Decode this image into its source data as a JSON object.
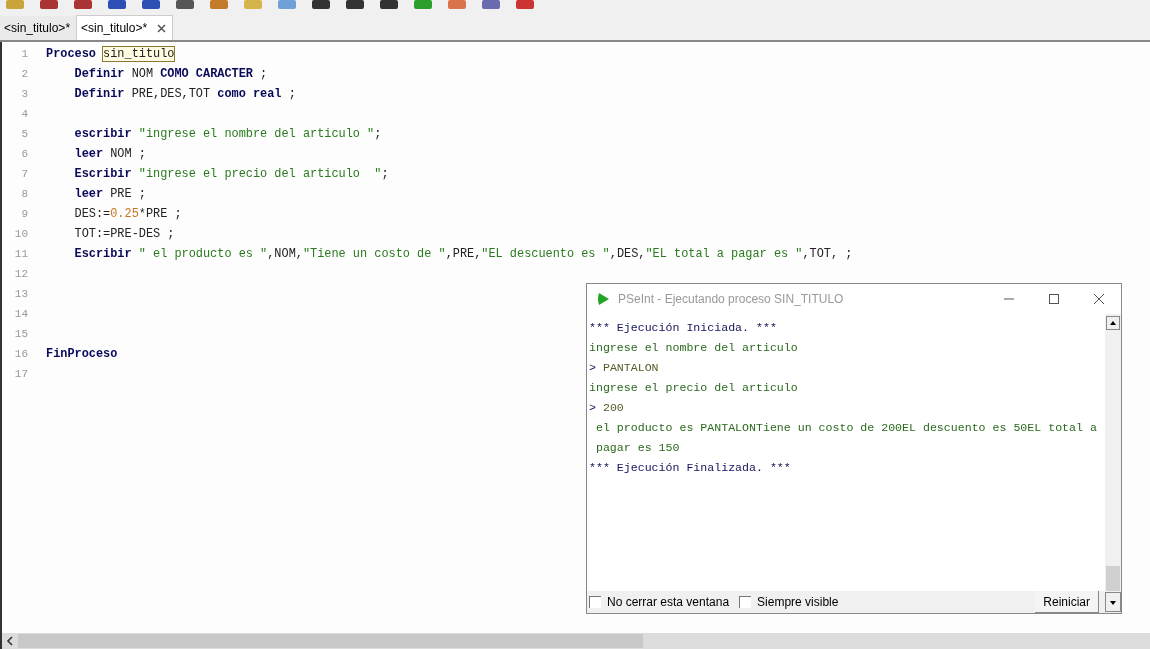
{
  "tabs": [
    {
      "label": "<sin_titulo>*",
      "selected": false,
      "closable": false
    },
    {
      "label": "<sin_titulo>*",
      "selected": true,
      "closable": true
    }
  ],
  "editor": {
    "lines": [
      {
        "number": "1",
        "tokens": [
          {
            "kind": "kw",
            "text": "Proceso "
          },
          {
            "kind": "hl",
            "text": "sin_titulo"
          }
        ]
      },
      {
        "number": "2",
        "tokens": [
          {
            "kind": "kw",
            "text": "    Definir "
          },
          {
            "kind": "id",
            "text": "NOM "
          },
          {
            "kind": "kw",
            "text": "COMO CARACTER "
          },
          {
            "kind": "id",
            "text": ";"
          }
        ]
      },
      {
        "number": "3",
        "tokens": [
          {
            "kind": "kw",
            "text": "    Definir "
          },
          {
            "kind": "id",
            "text": "PRE,DES,TOT "
          },
          {
            "kind": "kw",
            "text": "como real "
          },
          {
            "kind": "id",
            "text": ";"
          }
        ]
      },
      {
        "number": "4"
      },
      {
        "number": "5",
        "tokens": [
          {
            "kind": "kw",
            "text": "    escribir "
          },
          {
            "kind": "str",
            "text": "\"ingrese el nombre del articulo \""
          },
          {
            "kind": "id",
            "text": ";"
          }
        ]
      },
      {
        "number": "6",
        "tokens": [
          {
            "kind": "kw",
            "text": "    leer "
          },
          {
            "kind": "id",
            "text": "NOM ;"
          }
        ]
      },
      {
        "number": "7",
        "tokens": [
          {
            "kind": "kw",
            "text": "    Escribir "
          },
          {
            "kind": "str",
            "text": "\"ingrese el precio del articulo  \""
          },
          {
            "kind": "id",
            "text": ";"
          }
        ]
      },
      {
        "number": "8",
        "tokens": [
          {
            "kind": "kw",
            "text": "    leer "
          },
          {
            "kind": "id",
            "text": "PRE ;"
          }
        ]
      },
      {
        "number": "9",
        "tokens": [
          {
            "kind": "id",
            "text": "    DES:="
          },
          {
            "kind": "num",
            "text": "0.25"
          },
          {
            "kind": "id",
            "text": "*PRE ;"
          }
        ]
      },
      {
        "number": "10",
        "tokens": [
          {
            "kind": "id",
            "text": "    TOT:=PRE-DES ;"
          }
        ]
      },
      {
        "number": "11",
        "tokens": [
          {
            "kind": "kw",
            "text": "    Escribir "
          },
          {
            "kind": "str",
            "text": "\" el producto es \""
          },
          {
            "kind": "id",
            "text": ",NOM,"
          },
          {
            "kind": "str",
            "text": "\"Tiene un costo de \""
          },
          {
            "kind": "id",
            "text": ",PRE,"
          },
          {
            "kind": "str",
            "text": "\"EL descuento es \""
          },
          {
            "kind": "id",
            "text": ",DES,"
          },
          {
            "kind": "str",
            "text": "\"EL total a pagar es \""
          },
          {
            "kind": "id",
            "text": ",TOT, ;"
          }
        ]
      },
      {
        "number": "12"
      },
      {
        "number": "13"
      },
      {
        "number": "14"
      },
      {
        "number": "15"
      },
      {
        "number": "16",
        "tokens": [
          {
            "kind": "kw",
            "text": "FinProceso"
          }
        ]
      },
      {
        "number": "17"
      }
    ]
  },
  "console": {
    "title": "PSeInt - Ejecutando proceso SIN_TITULO",
    "lines": [
      {
        "kind": "status",
        "text": "*** Ejecución Iniciada. ***"
      },
      {
        "kind": "output",
        "text": "ingrese el nombre del articulo"
      },
      {
        "kind": "input",
        "prompt": ">",
        "text": "PANTALON"
      },
      {
        "kind": "output",
        "text": "ingrese el precio del articulo"
      },
      {
        "kind": "input",
        "prompt": ">",
        "text": "200"
      },
      {
        "kind": "output",
        "text": " el producto es PANTALONTiene un costo de 200EL descuento es 50EL total a"
      },
      {
        "kind": "output",
        "text": " pagar es 150"
      },
      {
        "kind": "status",
        "text": "*** Ejecución Finalizada. ***"
      }
    ],
    "options": [
      {
        "label": "No cerrar esta ventana",
        "checked": false
      },
      {
        "label": "Siempre visible",
        "checked": false
      }
    ],
    "button": "Reiniciar"
  }
}
